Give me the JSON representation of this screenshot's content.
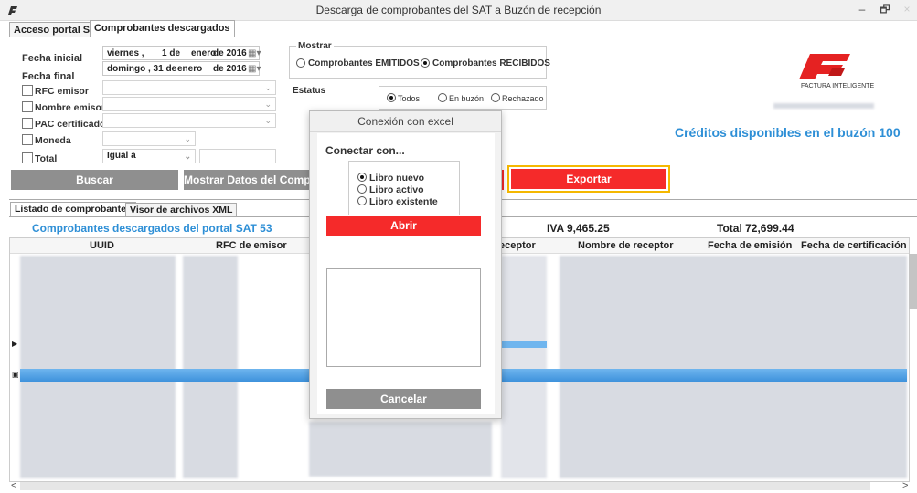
{
  "window": {
    "title": "Descarga de comprobantes del SAT a Buzón de recepción",
    "minimize": "–",
    "maximize": "🗗",
    "close": "×"
  },
  "tabs": [
    {
      "label": "Acceso portal SAT"
    },
    {
      "label": "Comprobantes descargados"
    }
  ],
  "filters": {
    "fecha_inicial_label": "Fecha inicial",
    "fecha_final_label": "Fecha final",
    "fecha_inicial": {
      "weekday": "viernes ,",
      "day": "1 de",
      "month": "enero",
      "year": "de 2016"
    },
    "fecha_final": {
      "weekday": "domingo , 31 de",
      "month": "enero",
      "year": "de 2016"
    },
    "rfc_emisor": "RFC emisor",
    "nombre_emisor": "Nombre emisor",
    "pac_certificador": "PAC certificador",
    "moneda": "Moneda",
    "total": "Total",
    "total_operator": "Igual a"
  },
  "mostrar": {
    "title": "Mostrar",
    "emitidos": "Comprobantes EMITIDOS",
    "recibidos": "Comprobantes RECIBIDOS",
    "selected": "recibidos"
  },
  "estatus": {
    "title": "Estatus",
    "todos": "Todos",
    "en_buzon": "En buzón",
    "rechazado": "Rechazado",
    "selected": "todos"
  },
  "buttons": {
    "buscar": "Buscar",
    "mostrar_datos": "Mostrar Datos del Compro",
    "exportar": "Exportar"
  },
  "brand": {
    "name": "FACTURA INTELIGENTE",
    "color": "#e52222"
  },
  "credits": "Créditos disponibles en el buzón 100",
  "lower_tabs": [
    {
      "label": "Listado de comprobantes"
    },
    {
      "label": "Visor de archivos XML"
    }
  ],
  "summary": {
    "descargados": "Comprobantes descargados del portal SAT 53",
    "iva": "IVA 9,465.25",
    "total": "Total 72,699.44"
  },
  "columns": [
    "UUID",
    "RFC de emisor",
    "eceptor",
    "Nombre de receptor",
    "Fecha de emisión",
    "Fecha de certificación"
  ],
  "dialog": {
    "title": "Conexión con excel",
    "conectar": "Conectar con...",
    "options": [
      "Libro nuevo",
      "Libro activo",
      "Libro existente"
    ],
    "selected": "Libro nuevo",
    "abrir": "Abrir",
    "cancelar": "Cancelar"
  },
  "scroll": {
    "left": "<",
    "right": ">"
  },
  "colors": {
    "accent_blue": "#2e8fd6",
    "red": "#f52a2a",
    "highlight": "#f5b800",
    "gray_button": "#8f8f8f"
  }
}
